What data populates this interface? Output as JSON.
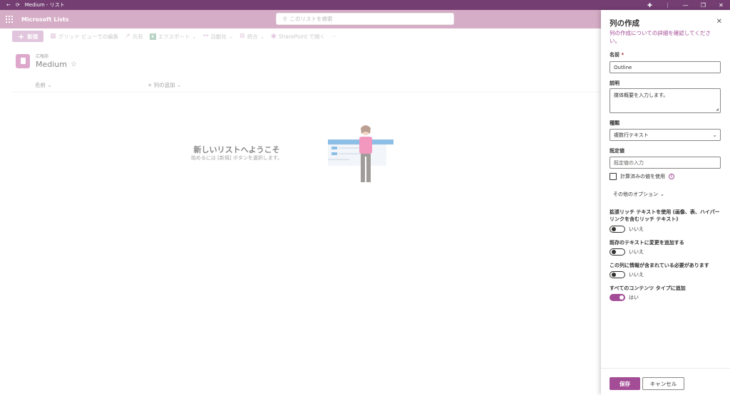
{
  "titlebar": {
    "title": "Medium - リスト"
  },
  "appbar": {
    "app_name": "Microsoft Lists",
    "search_placeholder": "このリストを検索"
  },
  "commandbar": {
    "new_label": "新規",
    "grid_edit_label": "グリッド ビューでの編集",
    "share_label": "共有",
    "export_label": "エクスポート",
    "automate_label": "自動化",
    "integrate_label": "統合",
    "sharepoint_label": "SharePoint で開く"
  },
  "list": {
    "site_name": "広報部",
    "title": "Medium"
  },
  "columns": {
    "name": "名前",
    "add_column": "列の追加"
  },
  "empty": {
    "title": "新しいリストへようこそ",
    "subtitle": "始めるには [新規] ボタンを選択します。"
  },
  "panel": {
    "title": "列の作成",
    "help_link": "列の作成についての詳細を確認してください。",
    "name_label": "名前",
    "required_mark": "*",
    "name_value": "Outline",
    "description_label": "説明",
    "description_value": "媒体概要を入力します。",
    "type_label": "種類",
    "type_value": "複数行テキスト",
    "default_label": "既定値",
    "default_placeholder": "既定値の入力",
    "calc_label": "計算済みの値を使用",
    "more_options": "その他のオプション",
    "rich_text_label": "拡張リッチ テキストを使用 (画像、表、ハイパーリンクを含むリッチ テキスト)",
    "rich_text_value": "いいえ",
    "append_label": "既存のテキストに変更を追加する",
    "append_value": "いいえ",
    "require_label": "この列に情報が含まれている必要があります",
    "require_value": "いいえ",
    "all_ct_label": "すべてのコンテンツ タイプに追加",
    "all_ct_value": "はい",
    "save_label": "保存",
    "cancel_label": "キャンセル"
  },
  "colors": {
    "accent": "#a34d96",
    "titlebar": "#743e72",
    "appbar": "#b9739f"
  }
}
